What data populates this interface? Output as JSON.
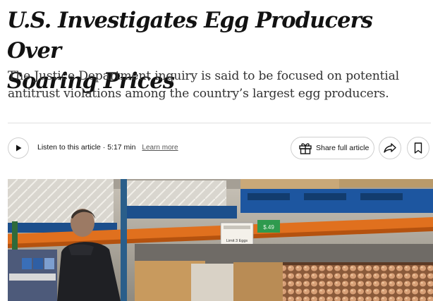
{
  "article": {
    "headline_line1": "U.S. Investigates Egg Producers Over",
    "headline_line2": "Soaring Prices",
    "summary": "The Justice Department inquiry is said to be focused on potential antitrust violations among the country’s largest egg producers."
  },
  "toolbar": {
    "listen_label": "Listen to this article · 5:17 min",
    "learn_more": "Learn more",
    "share_label": "Share full article",
    "icons": [
      "play-icon",
      "gift-icon",
      "share-icon",
      "bookmark-icon"
    ]
  },
  "photo": {
    "sign_text": "Limit 3 Eggs",
    "price_tag": "$.49"
  },
  "colors": {
    "text": "#121212",
    "summary_text": "#333333",
    "border": "#cfcfcf",
    "shelf_orange": "#e0701e",
    "pallet_blue": "#1c4f8c"
  }
}
